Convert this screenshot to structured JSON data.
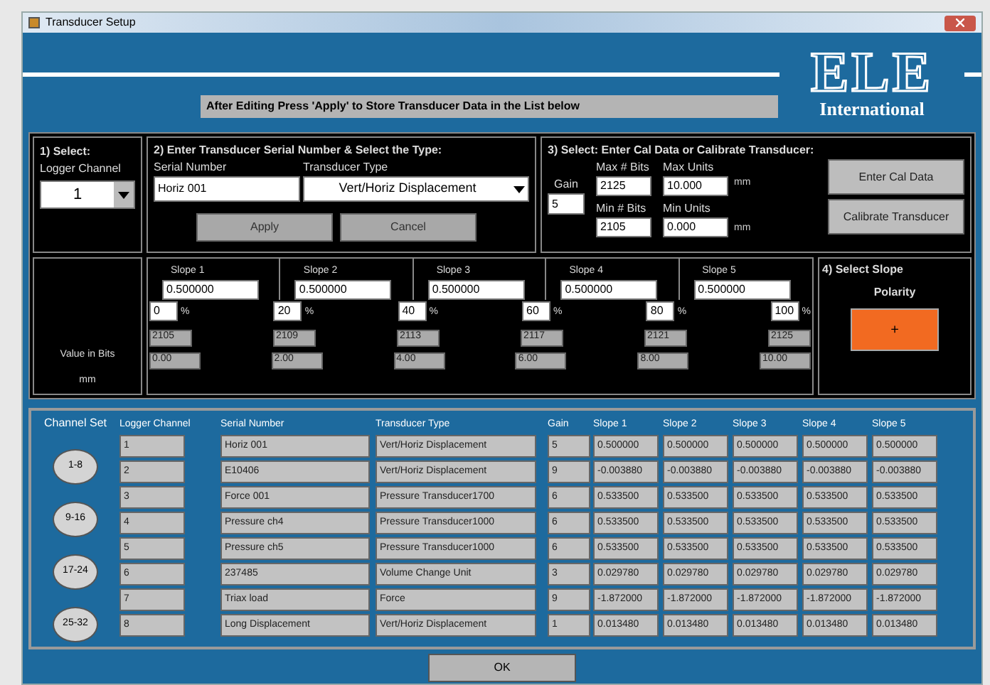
{
  "window": {
    "title": "Transducer Setup"
  },
  "logo": {
    "name": "ELE",
    "subtitle": "International"
  },
  "instruction": "After Editing Press 'Apply' to Store Transducer Data in the List below",
  "step1": {
    "heading": "1)  Select:",
    "label": "Logger Channel",
    "value": "1"
  },
  "step2": {
    "heading": "2)  Enter Transducer Serial Number & Select the Type:",
    "serial_label": "Serial Number",
    "serial_value": "Horiz 001",
    "type_label": "Transducer Type",
    "type_value": "Vert/Horiz Displacement",
    "buttons": [
      "Apply",
      "Cancel"
    ]
  },
  "step3": {
    "heading": "3)  Select:  Enter Cal Data  or  Calibrate Transducer:",
    "gain_label": "Gain",
    "gain_value": "5",
    "max_bits_label": "Max # Bits",
    "max_bits": "2125",
    "min_bits_label": "Min # Bits",
    "min_bits": "2105",
    "max_units_label": "Max Units",
    "max_units": "10.000",
    "min_units_label": "Min Units",
    "min_units": "0.000",
    "unit_max": "mm",
    "unit_min": "mm",
    "buttons": [
      "Enter Cal Data",
      "Calibrate Transducer"
    ]
  },
  "slopes_panel": {
    "bits_label": "Value in Bits",
    "mm_label": "mm",
    "percent_sign": "%",
    "slopes": [
      {
        "label": "Slope 1",
        "value": "0.500000"
      },
      {
        "label": "Slope 2",
        "value": "0.500000"
      },
      {
        "label": "Slope 3",
        "value": "0.500000"
      },
      {
        "label": "Slope 4",
        "value": "0.500000"
      },
      {
        "label": "Slope 5",
        "value": "0.500000"
      }
    ],
    "points": [
      {
        "percent": "0",
        "bits": "2105",
        "mm": "0.00"
      },
      {
        "percent": "20",
        "bits": "2109",
        "mm": "2.00"
      },
      {
        "percent": "40",
        "bits": "2113",
        "mm": "4.00"
      },
      {
        "percent": "60",
        "bits": "2117",
        "mm": "6.00"
      },
      {
        "percent": "80",
        "bits": "2121",
        "mm": "8.00"
      },
      {
        "percent": "100",
        "bits": "2125",
        "mm": "10.00"
      }
    ]
  },
  "step4": {
    "heading": "4)  Select Slope",
    "label": "Polarity",
    "button": "+"
  },
  "channel_sets": {
    "heading": "Channel Set",
    "buttons": [
      "1-8",
      "9-16",
      "17-24",
      "25-32"
    ]
  },
  "table": {
    "columns": [
      "Logger Channel",
      "Serial Number",
      "Transducer Type",
      "Gain",
      "Slope 1",
      "Slope 2",
      "Slope 3",
      "Slope 4",
      "Slope 5"
    ],
    "rows": [
      [
        "1",
        "Horiz 001",
        "Vert/Horiz Displacement",
        "5",
        "0.500000",
        "0.500000",
        "0.500000",
        "0.500000",
        "0.500000"
      ],
      [
        "2",
        "E10406",
        "Vert/Horiz Displacement",
        "9",
        "-0.003880",
        "-0.003880",
        "-0.003880",
        "-0.003880",
        "-0.003880"
      ],
      [
        "3",
        "Force 001",
        "Pressure Transducer1700",
        "6",
        "0.533500",
        "0.533500",
        "0.533500",
        "0.533500",
        "0.533500"
      ],
      [
        "4",
        "Pressure ch4",
        "Pressure Transducer1000",
        "6",
        "0.533500",
        "0.533500",
        "0.533500",
        "0.533500",
        "0.533500"
      ],
      [
        "5",
        "Pressure ch5",
        "Pressure Transducer1000",
        "6",
        "0.533500",
        "0.533500",
        "0.533500",
        "0.533500",
        "0.533500"
      ],
      [
        "6",
        "237485",
        "Volume Change Unit",
        "3",
        "0.029780",
        "0.029780",
        "0.029780",
        "0.029780",
        "0.029780"
      ],
      [
        "7",
        "Triax load",
        "Force",
        "9",
        "-1.872000",
        "-1.872000",
        "-1.872000",
        "-1.872000",
        "-1.872000"
      ],
      [
        "8",
        "Long Displacement",
        "Vert/Horiz Displacement",
        "1",
        "0.013480",
        "0.013480",
        "0.013480",
        "0.013480",
        "0.013480"
      ]
    ]
  },
  "ok_button": "OK"
}
